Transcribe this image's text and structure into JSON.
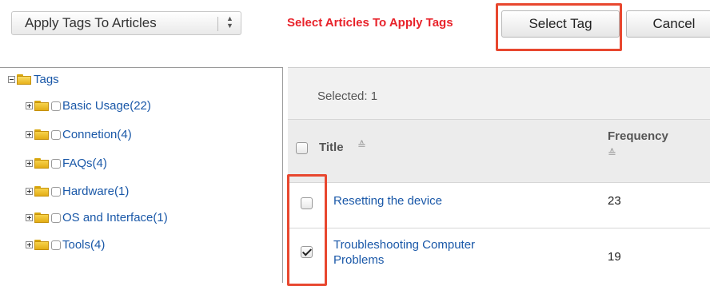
{
  "toolbar": {
    "action_select": "Apply Tags To Articles",
    "instruction": "Select Articles To Apply Tags",
    "select_tag_label": "Select Tag",
    "cancel_label": "Cancel"
  },
  "tree": {
    "root_label": "Tags",
    "items": [
      {
        "label": "Basic Usage(22)"
      },
      {
        "label": "Connetion(4)"
      },
      {
        "label": "FAQs(4)"
      },
      {
        "label": "Hardware(1)"
      },
      {
        "label": "OS and Interface(1)"
      },
      {
        "label": "Tools(4)"
      }
    ]
  },
  "articles": {
    "selected_text": "Selected: 1",
    "columns": {
      "title": "Title",
      "frequency": "Frequency"
    },
    "rows": [
      {
        "title": "Resetting the device",
        "frequency": "23",
        "checked": false
      },
      {
        "title": "Troubleshooting Computer Problems",
        "frequency": "19",
        "checked": true
      }
    ]
  },
  "colors": {
    "instruction_red": "#e8232b",
    "highlight": "#e8472f",
    "link_blue": "#1a58a8"
  },
  "icons": [
    "tree-expander-icon",
    "folder-icon",
    "sort-icon",
    "select-arrows-icon"
  ]
}
